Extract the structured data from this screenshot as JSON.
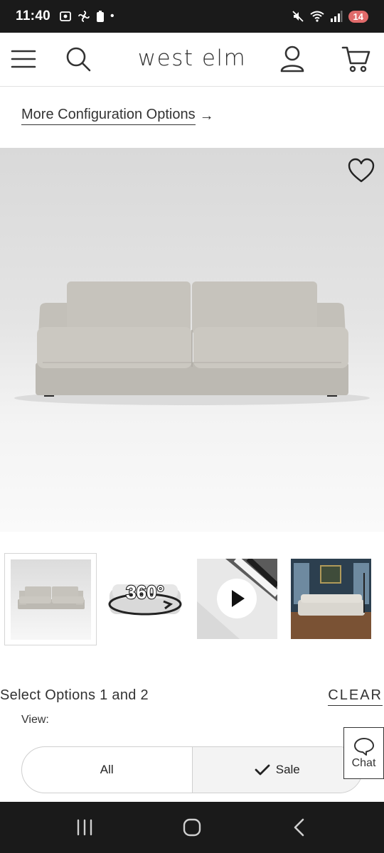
{
  "status_bar": {
    "time": "11:40",
    "dot": "•",
    "battery_level": "14",
    "icons": [
      "screenshot-icon",
      "fan-icon",
      "battery-saver-icon",
      "mute-icon",
      "wifi-icon",
      "signal-icon"
    ]
  },
  "header": {
    "logo": "west elm",
    "icons": [
      "menu-icon",
      "search-icon",
      "account-icon",
      "cart-icon"
    ]
  },
  "config_link": {
    "label": "More Configuration Options",
    "arrow": "→"
  },
  "hero": {
    "favorite_icon": "heart-outline-icon"
  },
  "thumbnails": [
    {
      "type": "image",
      "active": true
    },
    {
      "type": "360-view",
      "label": "360°"
    },
    {
      "type": "video",
      "icon": "play-icon"
    },
    {
      "type": "room-image"
    }
  ],
  "options": {
    "title": "Select Options 1 and 2",
    "clear_label": "CLEAR",
    "view_label": "View:",
    "toggle": {
      "all_label": "All",
      "sale_label": "Sale",
      "selected": "Sale"
    }
  },
  "chat": {
    "label": "Chat"
  },
  "colors": {
    "status_bar_bg": "#1a1a1a",
    "battery_badge": "#e06a6a",
    "text": "#333333",
    "sofa": "#bdbab3"
  }
}
